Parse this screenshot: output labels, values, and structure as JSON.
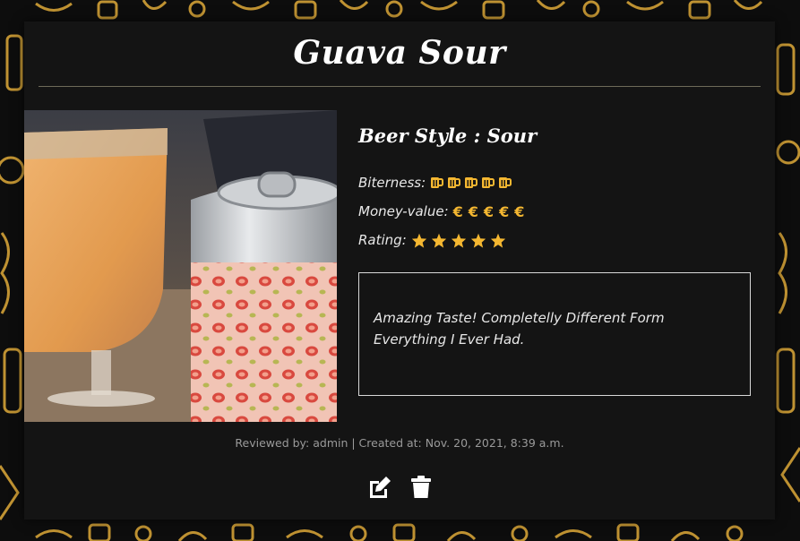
{
  "page": {
    "title": "Guava Sour",
    "beer_style": "Beer Style : Sour",
    "bitterness_label": "Biterness:",
    "bitterness_level": 5,
    "money_value_label": "Money-value:",
    "money_value_level": 5,
    "money_symbol": "€",
    "rating_label": "Rating:",
    "rating_level": 5,
    "review_text": "Amazing Taste! Completelly Different Form Everything I Ever Had.",
    "meta_line": "Reviewed by: admin | Created at: Nov. 20, 2021, 8:39 a.m.",
    "icons": {
      "bitterness": "beer-mug-icon",
      "rating": "star-icon",
      "edit": "edit-icon",
      "delete": "trash-icon"
    }
  },
  "colors": {
    "accent": "#f4b731",
    "card_background": "#141414",
    "page_background": "#0d0d0d"
  }
}
